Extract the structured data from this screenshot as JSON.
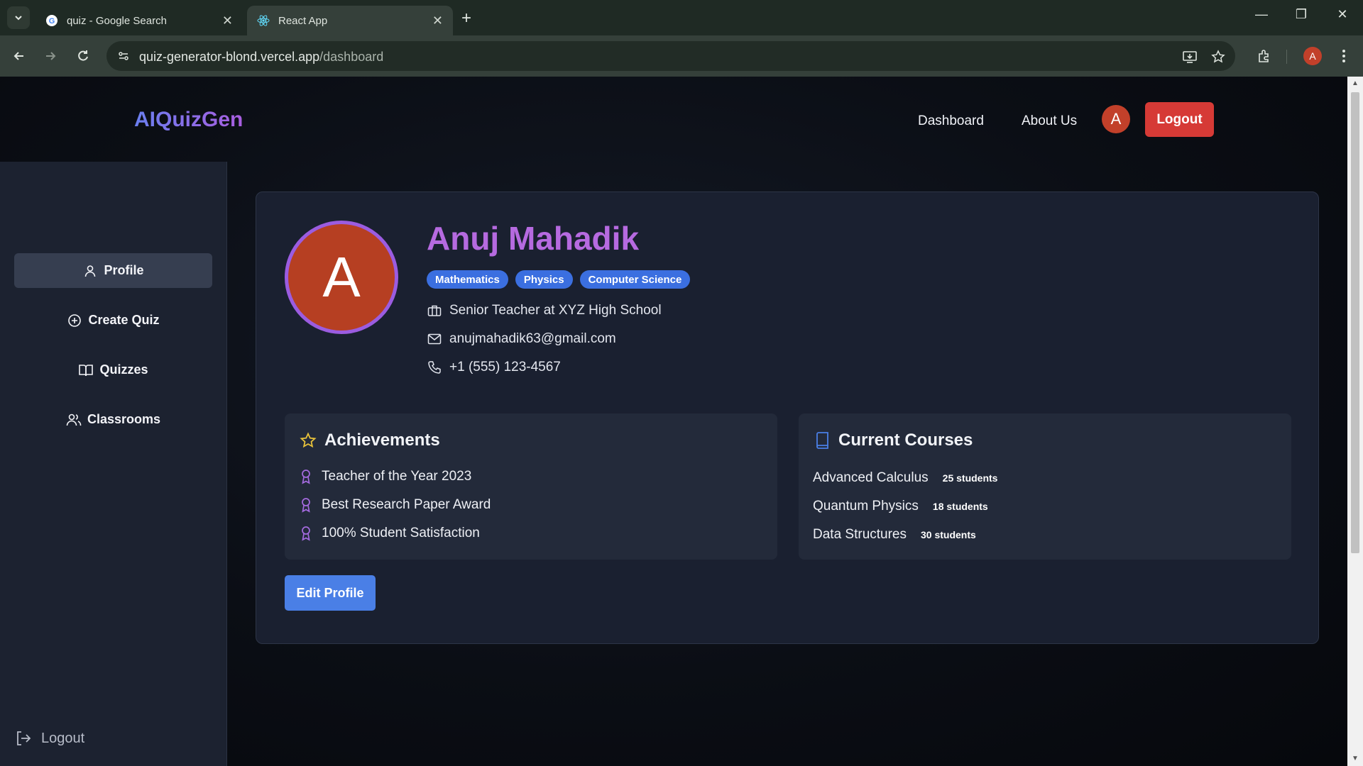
{
  "browser": {
    "tabs": [
      {
        "title": "quiz - Google Search",
        "active": false,
        "favicon": "google-icon"
      },
      {
        "title": "React App",
        "active": true,
        "favicon": "react-icon"
      }
    ],
    "url_host": "quiz-generator-blond.vercel.app",
    "url_path": "/dashboard",
    "profile_initial": "A"
  },
  "nav": {
    "brand": "AIQuizGen",
    "links": [
      "Dashboard",
      "About Us"
    ],
    "avatar_initial": "A",
    "logout_label": "Logout"
  },
  "sidebar": {
    "items": [
      {
        "label": "Profile",
        "icon": "user-icon",
        "active": true
      },
      {
        "label": "Create Quiz",
        "icon": "plus-circle-icon",
        "active": false
      },
      {
        "label": "Quizzes",
        "icon": "book-open-icon",
        "active": false
      },
      {
        "label": "Classrooms",
        "icon": "users-icon",
        "active": false
      }
    ],
    "logout_label": "Logout"
  },
  "profile": {
    "avatar_initial": "A",
    "name": "Anuj Mahadik",
    "tags": [
      "Mathematics",
      "Physics",
      "Computer Science"
    ],
    "role": "Senior Teacher at XYZ High School",
    "email": "anujmahadik63@gmail.com",
    "phone": "+1 (555) 123-4567",
    "edit_label": "Edit Profile"
  },
  "achievements": {
    "title": "Achievements",
    "items": [
      "Teacher of the Year 2023",
      "Best Research Paper Award",
      "100% Student Satisfaction"
    ]
  },
  "courses": {
    "title": "Current Courses",
    "items": [
      {
        "name": "Advanced Calculus",
        "students": "25 students"
      },
      {
        "name": "Quantum Physics",
        "students": "18 students"
      },
      {
        "name": "Data Structures",
        "students": "30 students"
      }
    ]
  },
  "colors": {
    "accent_purple": "#b66ae0",
    "tag_blue": "#3b6fe0",
    "logout_red": "#d63a36",
    "avatar_orange": "#b63f22"
  }
}
